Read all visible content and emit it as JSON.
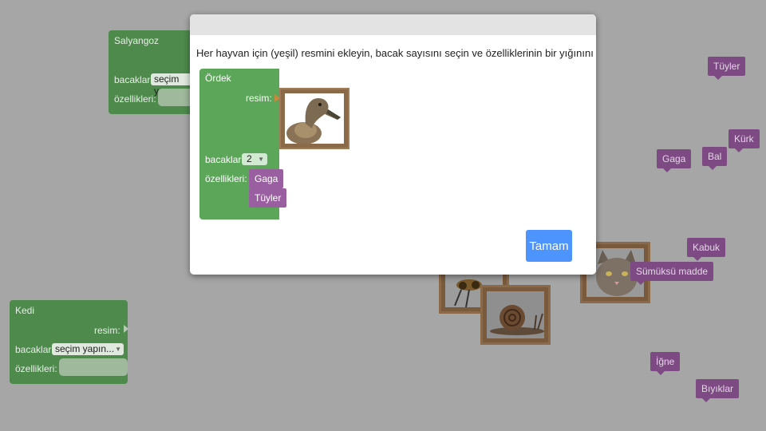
{
  "dialog": {
    "instruction": "Her hayvan için (yeşil) resmini ekleyin, bacak sayısını seçin ve özelliklerinin bir yığınını yapın.",
    "ok_label": "Tamam",
    "block": {
      "title": "Ördek",
      "image_label": "resim:",
      "legs_label": "bacaklar:",
      "legs_value": "2",
      "attributes_label": "özellikleri:",
      "attributes": [
        "Gaga",
        "Tüyler"
      ]
    }
  },
  "workspace": {
    "snail_block": {
      "title": "Salyangoz",
      "legs_label": "bacaklar:",
      "legs_value": "seçim yap",
      "attributes_label": "özellikleri:"
    },
    "cat_block": {
      "title": "Kedi",
      "image_label": "resim:",
      "legs_label": "bacaklar:",
      "legs_value": "seçim yapın...",
      "attributes_label": "özellikleri:"
    },
    "attribute_blocks": [
      "Tüyler",
      "Kürk",
      "Gaga",
      "Bal",
      "Kabuk",
      "Sümüksü madde",
      "İğne",
      "Bıyıklar"
    ],
    "pictures": [
      "bee-picture",
      "snail-picture",
      "cat-picture"
    ]
  },
  "colors": {
    "background": "#a6a6a6",
    "animal_block": "#5ba658",
    "attribute_block": "#9a5fa0",
    "ok_button": "#4d94ff"
  }
}
